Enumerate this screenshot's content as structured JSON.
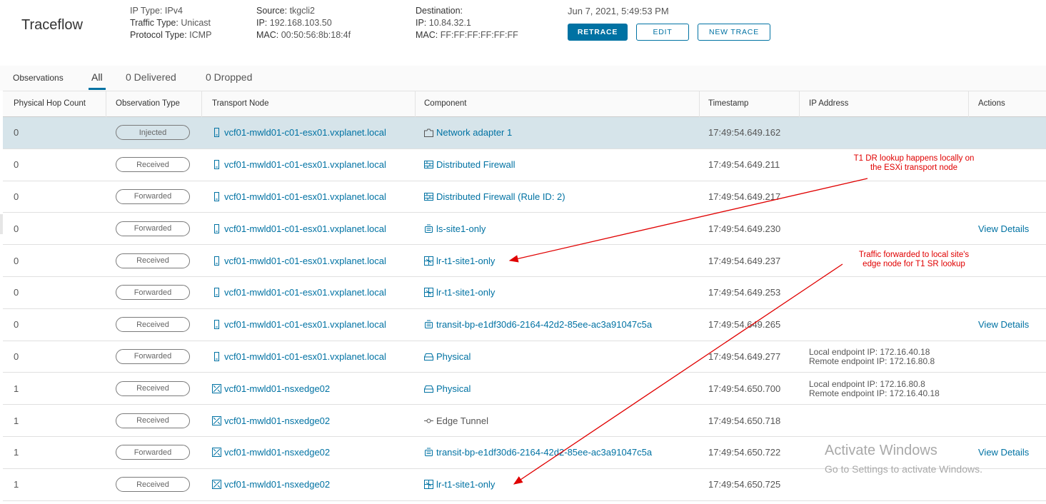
{
  "header": {
    "title": "Traceflow",
    "ip_type_label": "IP Type:",
    "ip_type": "IPv4",
    "traffic_type_label": "Traffic Type:",
    "traffic_type": "Unicast",
    "protocol_type_label": "Protocol Type:",
    "protocol_type": "ICMP",
    "source_label": "Source:",
    "source": "tkgcli2",
    "source_ip_label": "IP:",
    "source_ip": "192.168.103.50",
    "source_mac_label": "MAC:",
    "source_mac": "00:50:56:8b:18:4f",
    "dest_label": "Destination:",
    "dest_ip_label": "IP:",
    "dest_ip": "10.84.32.1",
    "dest_mac_label": "MAC:",
    "dest_mac": "FF:FF:FF:FF:FF:FF",
    "timestamp": "Jun 7, 2021, 5:49:53 PM",
    "retrace_label": "RETRACE",
    "edit_label": "EDIT",
    "new_trace_label": "NEW TRACE"
  },
  "tabs": {
    "label": "Observations",
    "all": "All",
    "delivered": "0 Delivered",
    "dropped": "0 Dropped"
  },
  "columns": [
    "Physical Hop Count",
    "Observation Type",
    "Transport Node",
    "Component",
    "Timestamp",
    "IP Address",
    "Actions"
  ],
  "rows": [
    {
      "hop": "0",
      "type": "Injected",
      "node": "vcf01-mwld01-c01-esx01.vxplanet.local",
      "node_icon": "host-icon",
      "component": "Network adapter 1",
      "comp_icon": "network-adapter-icon",
      "comp_link": true,
      "timestamp": "17:49:54.649.162",
      "ip1": "",
      "ip2": "",
      "action": ""
    },
    {
      "hop": "0",
      "type": "Received",
      "node": "vcf01-mwld01-c01-esx01.vxplanet.local",
      "node_icon": "host-icon",
      "component": "Distributed Firewall",
      "comp_icon": "firewall-icon",
      "comp_link": true,
      "timestamp": "17:49:54.649.211",
      "ip1": "",
      "ip2": "",
      "action": ""
    },
    {
      "hop": "0",
      "type": "Forwarded",
      "node": "vcf01-mwld01-c01-esx01.vxplanet.local",
      "node_icon": "host-icon",
      "component": "Distributed Firewall (Rule ID: 2)",
      "comp_icon": "firewall-icon",
      "comp_link": true,
      "timestamp": "17:49:54.649.217",
      "ip1": "",
      "ip2": "",
      "action": ""
    },
    {
      "hop": "0",
      "type": "Forwarded",
      "node": "vcf01-mwld01-c01-esx01.vxplanet.local",
      "node_icon": "host-icon",
      "component": "ls-site1-only",
      "comp_icon": "switch-icon",
      "comp_link": true,
      "timestamp": "17:49:54.649.230",
      "ip1": "",
      "ip2": "",
      "action": "View Details"
    },
    {
      "hop": "0",
      "type": "Received",
      "node": "vcf01-mwld01-c01-esx01.vxplanet.local",
      "node_icon": "host-icon",
      "component": "lr-t1-site1-only",
      "comp_icon": "router-icon",
      "comp_link": true,
      "timestamp": "17:49:54.649.237",
      "ip1": "",
      "ip2": "",
      "action": ""
    },
    {
      "hop": "0",
      "type": "Forwarded",
      "node": "vcf01-mwld01-c01-esx01.vxplanet.local",
      "node_icon": "host-icon",
      "component": "lr-t1-site1-only",
      "comp_icon": "router-icon",
      "comp_link": true,
      "timestamp": "17:49:54.649.253",
      "ip1": "",
      "ip2": "",
      "action": ""
    },
    {
      "hop": "0",
      "type": "Received",
      "node": "vcf01-mwld01-c01-esx01.vxplanet.local",
      "node_icon": "host-icon",
      "component": "transit-bp-e1df30d6-2164-42d2-85ee-ac3a91047c5a",
      "comp_icon": "switch-icon",
      "comp_link": true,
      "timestamp": "17:49:54.649.265",
      "ip1": "",
      "ip2": "",
      "action": "View Details"
    },
    {
      "hop": "0",
      "type": "Forwarded",
      "node": "vcf01-mwld01-c01-esx01.vxplanet.local",
      "node_icon": "host-icon",
      "component": "Physical",
      "comp_icon": "physical-icon",
      "comp_link": true,
      "timestamp": "17:49:54.649.277",
      "ip1": "Local endpoint IP: 172.16.40.18",
      "ip2": "Remote endpoint IP: 172.16.80.8",
      "action": ""
    },
    {
      "hop": "1",
      "type": "Received",
      "node": "vcf01-mwld01-nsxedge02",
      "node_icon": "edge-icon",
      "component": "Physical",
      "comp_icon": "physical-icon",
      "comp_link": true,
      "timestamp": "17:49:54.650.700",
      "ip1": "Local endpoint IP: 172.16.80.8",
      "ip2": "Remote endpoint IP: 172.16.40.18",
      "action": ""
    },
    {
      "hop": "1",
      "type": "Received",
      "node": "vcf01-mwld01-nsxedge02",
      "node_icon": "edge-icon",
      "component": "Edge Tunnel",
      "comp_icon": "tunnel-icon",
      "comp_link": false,
      "timestamp": "17:49:54.650.718",
      "ip1": "",
      "ip2": "",
      "action": ""
    },
    {
      "hop": "1",
      "type": "Forwarded",
      "node": "vcf01-mwld01-nsxedge02",
      "node_icon": "edge-icon",
      "component": "transit-bp-e1df30d6-2164-42d2-85ee-ac3a91047c5a",
      "comp_icon": "switch-icon",
      "comp_link": true,
      "timestamp": "17:49:54.650.722",
      "ip1": "",
      "ip2": "",
      "action": "View Details"
    },
    {
      "hop": "1",
      "type": "Received",
      "node": "vcf01-mwld01-nsxedge02",
      "node_icon": "edge-icon",
      "component": "lr-t1-site1-only",
      "comp_icon": "router-icon",
      "comp_link": true,
      "timestamp": "17:49:54.650.725",
      "ip1": "",
      "ip2": "",
      "action": ""
    }
  ],
  "annotations": {
    "a1_line1": "T1 DR lookup happens locally on",
    "a1_line2": "the ESXi transport node",
    "a2_line1": "Traffic forwarded to local site's",
    "a2_line2": "edge node for T1 SR lookup",
    "color": "#e00000"
  },
  "watermark": {
    "line1": "Activate Windows",
    "line2": "Go to Settings to activate Windows."
  },
  "colors": {
    "accent": "#0072a3",
    "selected_row": "#d6e4ea"
  }
}
